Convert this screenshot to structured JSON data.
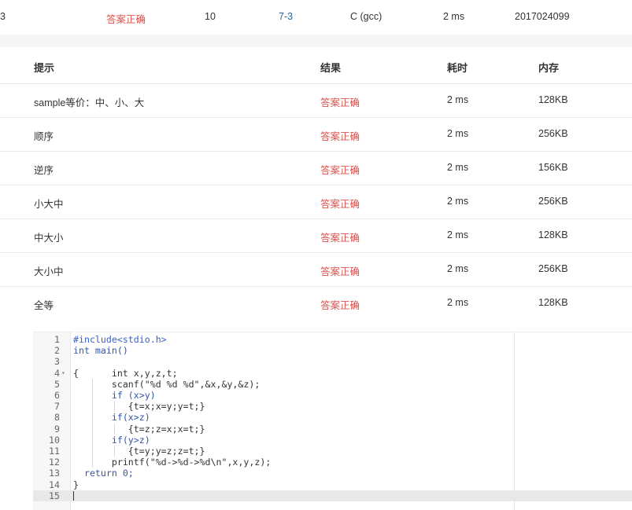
{
  "submission": {
    "id_fragment": "3",
    "status": "答案正确",
    "score": "10",
    "problem": "7-3",
    "compiler": "C (gcc)",
    "time": "2 ms",
    "user": "2017024099"
  },
  "cases_table": {
    "headers": {
      "hint": "提示",
      "result": "结果",
      "time": "耗时",
      "memory": "内存"
    },
    "rows": [
      {
        "hint": "sample等价：中、小、大",
        "result": "答案正确",
        "time": "2 ms",
        "memory": "128KB"
      },
      {
        "hint": "顺序",
        "result": "答案正确",
        "time": "2 ms",
        "memory": "256KB"
      },
      {
        "hint": "逆序",
        "result": "答案正确",
        "time": "2 ms",
        "memory": "156KB"
      },
      {
        "hint": "小大中",
        "result": "答案正确",
        "time": "2 ms",
        "memory": "256KB"
      },
      {
        "hint": "中大小",
        "result": "答案正确",
        "time": "2 ms",
        "memory": "128KB"
      },
      {
        "hint": "大小中",
        "result": "答案正确",
        "time": "2 ms",
        "memory": "256KB"
      },
      {
        "hint": "全等",
        "result": "答案正确",
        "time": "2 ms",
        "memory": "128KB"
      }
    ]
  },
  "code_editor": {
    "lines": [
      "#include<stdio.h>",
      "int main()",
      "",
      "{      int x,y,z,t;",
      "       scanf(\"%d %d %d\",&x,&y,&z);",
      "       if (x>y)",
      "          {t=x;x=y;y=t;}",
      "       if(x>z)",
      "          {t=z;z=x;x=t;}",
      "       if(y>z)",
      "          {t=y;y=z;z=t;}",
      "       printf(\"%d->%d->%d\\n\",x,y,z);",
      "  return 0;",
      "}",
      ""
    ],
    "line_numbers": [
      "1",
      "2",
      "3",
      "4",
      "5",
      "6",
      "7",
      "8",
      "9",
      "10",
      "11",
      "12",
      "13",
      "14",
      "15"
    ],
    "fold_marker": "▾",
    "active_line": "15"
  }
}
